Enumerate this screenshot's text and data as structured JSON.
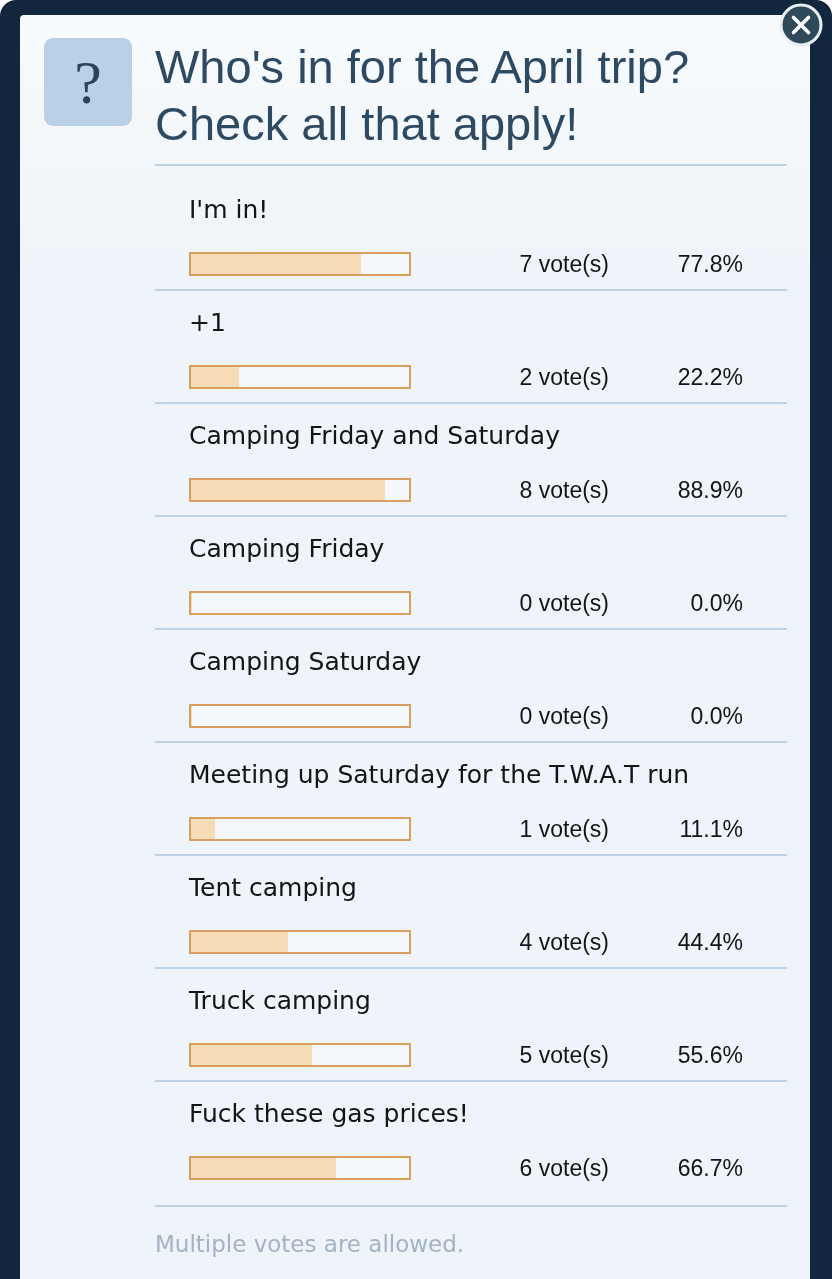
{
  "question": {
    "glyph": "?",
    "title": "Who's in for the April trip? Check all that apply!"
  },
  "options": [
    {
      "label": "I'm in!",
      "level": 0.778,
      "votes": "7 vote(s)",
      "percent": "77.8%"
    },
    {
      "label": "+1",
      "level": 0.222,
      "votes": "2 vote(s)",
      "percent": "22.2%"
    },
    {
      "label": "Camping Friday and Saturday",
      "level": 0.889,
      "votes": "8 vote(s)",
      "percent": "88.9%"
    },
    {
      "label": "Camping Friday",
      "level": 0,
      "votes": "0 vote(s)",
      "percent": "0.0%"
    },
    {
      "label": "Camping Saturday",
      "level": 0,
      "votes": "0 vote(s)",
      "percent": "0.0%"
    },
    {
      "label": "Meeting up Saturday for the T.W.A.T run",
      "level": 0.111,
      "votes": "1 vote(s)",
      "percent": "11.1%"
    },
    {
      "label": "Tent camping",
      "level": 0.444,
      "votes": "4 vote(s)",
      "percent": "44.4%"
    },
    {
      "label": "Truck camping",
      "level": 0.556,
      "votes": "5 vote(s)",
      "percent": "55.6%"
    },
    {
      "label": "Fuck these gas prices!",
      "level": 0.667,
      "votes": "6 vote(s)",
      "percent": "66.7%"
    }
  ],
  "footer_note": "Multiple votes are allowed."
}
